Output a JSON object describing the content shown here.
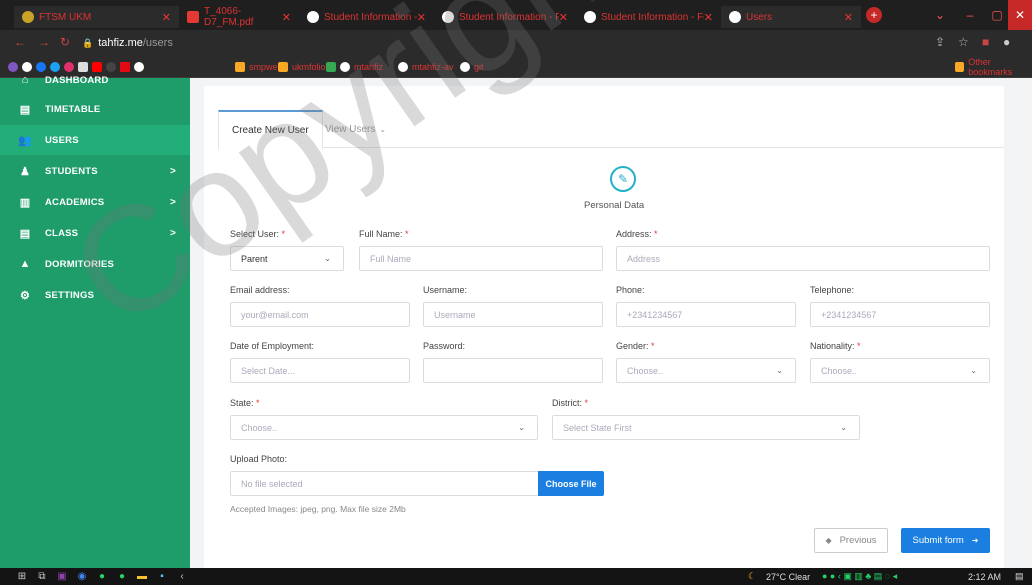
{
  "browser": {
    "tabs": [
      {
        "label": "FTSM UKM"
      },
      {
        "label": "T_4066-D7_FM.pdf"
      },
      {
        "label": "Student Information - Form"
      },
      {
        "label": "Student Information - Form"
      },
      {
        "label": "Student Information - Form"
      },
      {
        "label": "Users"
      }
    ],
    "url_host": "tahfiz.me",
    "url_path": "/users",
    "bookmarks": [
      {
        "label": "smpweb"
      },
      {
        "label": "ukmfolio"
      },
      {
        "label": "mtahfiz"
      },
      {
        "label": "mtahfiz-av"
      },
      {
        "label": "git"
      }
    ],
    "other_bookmarks": "Other bookmarks"
  },
  "sidebar": {
    "items": [
      {
        "label": "DASHBOARD",
        "icon": "home-icon"
      },
      {
        "label": "TIMETABLE",
        "icon": "timetable-icon"
      },
      {
        "label": "USERS",
        "icon": "users-icon"
      },
      {
        "label": "STUDENTS",
        "icon": "student-icon",
        "chevron": ">"
      },
      {
        "label": "ACADEMICS",
        "icon": "books-icon",
        "chevron": ">"
      },
      {
        "label": "CLASS",
        "icon": "class-icon",
        "chevron": ">"
      },
      {
        "label": "DORMITORIES",
        "icon": "house-icon"
      },
      {
        "label": "SETTINGS",
        "icon": "gear-icon"
      }
    ]
  },
  "tabs": {
    "create": "Create New User",
    "view": "View Users"
  },
  "form": {
    "section_title": "Personal Data",
    "select_user_label": "Select User:",
    "select_user_value": "Parent",
    "full_name_label": "Full Name:",
    "full_name_placeholder": "Full Name",
    "address_label": "Address:",
    "address_placeholder": "Address",
    "email_label": "Email address:",
    "email_placeholder": "your@email.com",
    "username_label": "Username:",
    "username_placeholder": "Username",
    "phone_label": "Phone:",
    "phone_placeholder": "+2341234567",
    "telephone_label": "Telephone:",
    "telephone_placeholder": "+2341234567",
    "employment_label": "Date of Employment:",
    "employment_placeholder": "Select Date...",
    "password_label": "Password:",
    "gender_label": "Gender:",
    "gender_placeholder": "Choose..",
    "nationality_label": "Nationality:",
    "nationality_placeholder": "Choose..",
    "state_label": "State:",
    "state_placeholder": "Choose..",
    "district_label": "District:",
    "district_placeholder": "Select State First",
    "upload_label": "Upload Photo:",
    "file_status": "No file selected",
    "choose_file": "Choose File",
    "upload_hint": "Accepted Images: jpeg, png. Max file size 2Mb",
    "required_mark": "*"
  },
  "buttons": {
    "previous": "Previous",
    "submit": "Submit form"
  },
  "taskbar": {
    "weather": "27°C  Clear",
    "time": "2:12 AM"
  },
  "watermark": "Copyright UKM"
}
